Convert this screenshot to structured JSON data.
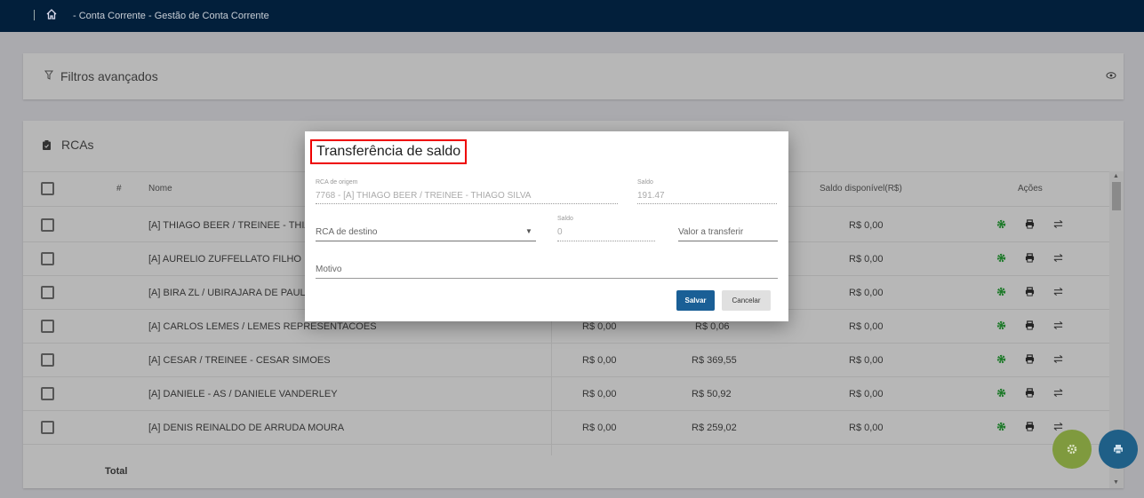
{
  "header": {
    "breadcrumb": "- Conta Corrente - Gestão de Conta Corrente"
  },
  "filters": {
    "label": "Filtros avançados"
  },
  "rcas": {
    "title": "RCAs",
    "columns": {
      "hash": "#",
      "name": "Nome",
      "col3": "",
      "col4": "",
      "saldo_disponivel": "Saldo disponível(R$)",
      "acoes": "Ações"
    },
    "rows": [
      {
        "name": "[A] THIAGO BEER / TREINEE - THIAGO SILVA",
        "c3": "",
        "c4": "",
        "saldo": "R$ 0,00"
      },
      {
        "name": "[A] AURELIO ZUFFELLATO FILHO",
        "c3": "",
        "c4": "",
        "saldo": "R$ 0,00"
      },
      {
        "name": "[A] BIRA ZL / UBIRAJARA DE PAULA",
        "c3": "",
        "c4": "",
        "saldo": "R$ 0,00"
      },
      {
        "name": "[A] CARLOS LEMES / LEMES REPRESENTACOES",
        "c3": "R$ 0,00",
        "c4": "R$ 0,06",
        "saldo": "R$ 0,00"
      },
      {
        "name": "[A] CESAR / TREINEE - CESAR SIMOES",
        "c3": "R$ 0,00",
        "c4": "R$ 369,55",
        "saldo": "R$ 0,00"
      },
      {
        "name": "[A] DANIELE - AS / DANIELE VANDERLEY",
        "c3": "R$ 0,00",
        "c4": "R$ 50,92",
        "saldo": "R$ 0,00"
      },
      {
        "name": "[A] DENIS REINALDO DE ARRUDA MOURA",
        "c3": "R$ 0,00",
        "c4": "R$ 259,02",
        "saldo": "R$ 0,00"
      }
    ],
    "total_label": "Total"
  },
  "modal": {
    "title": "Transferência de saldo",
    "origem_label": "RCA de origem",
    "origem_value": "7768 -   [A] THIAGO BEER / TREINEE - THIAGO SILVA",
    "saldo_label": "Saldo",
    "saldo_value": "191.47",
    "destino_placeholder": "RCA de destino",
    "saldo2_label": "Saldo",
    "saldo2_value": "0",
    "valor_placeholder": "Valor a transferir",
    "motivo_placeholder": "Motivo",
    "save": "Salvar",
    "cancel": "Cancelar"
  },
  "colors": {
    "accent": "#1a5f96",
    "fab_green": "#7f9a3e",
    "fab_blue": "#1f5f87",
    "gear_green": "#1e7a2a"
  }
}
